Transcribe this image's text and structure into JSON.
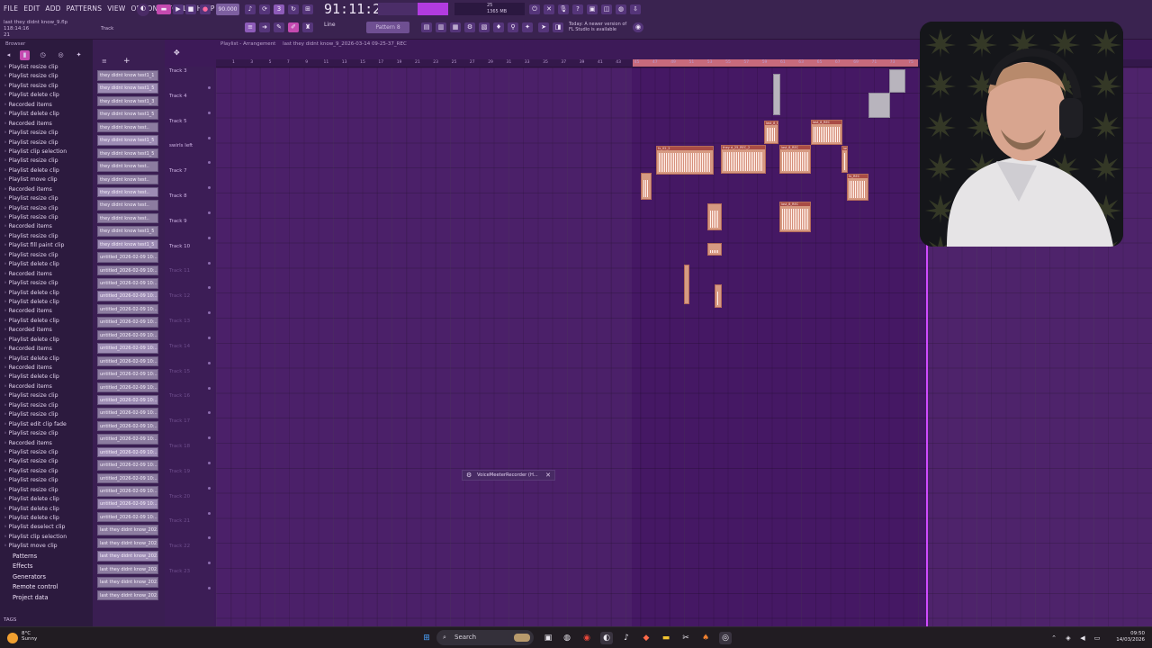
{
  "menu": [
    "FILE",
    "EDIT",
    "ADD",
    "PATTERNS",
    "VIEW",
    "OPTIONS",
    "TOOLS",
    "HELP"
  ],
  "song": {
    "name": "last they didnt know_9.flp",
    "time": "118:14:16",
    "track": "Track 21"
  },
  "transport": {
    "tempo": "90.000",
    "time": "91:11:23",
    "pattern": "Pattern 8",
    "snap": "Line",
    "memory": "1365 MB",
    "cpu": "25"
  },
  "news": {
    "line1": "Today:  A newer version of",
    "line2": "FL Studio is available"
  },
  "browser": {
    "title": "Browser",
    "history": [
      "Playlist resize clip",
      "Playlist resize clip",
      "Playlist resize clip",
      "Playlist delete clip",
      "Recorded items",
      "Playlist delete clip",
      "Recorded items",
      "Playlist resize clip",
      "Playlist resize clip",
      "Playlist clip selection",
      "Playlist resize clip",
      "Playlist delete clip",
      "Playlist move clip",
      "Recorded items",
      "Playlist resize clip",
      "Playlist resize clip",
      "Playlist resize clip",
      "Recorded items",
      "Playlist resize clip",
      "Playlist fill paint clip",
      "Playlist resize clip",
      "Playlist delete clip",
      "Recorded items",
      "Playlist resize clip",
      "Playlist delete clip",
      "Playlist delete clip",
      "Recorded items",
      "Playlist delete clip",
      "Recorded items",
      "Playlist delete clip",
      "Recorded items",
      "Playlist delete clip",
      "Recorded items",
      "Playlist delete clip",
      "Recorded items",
      "Playlist resize clip",
      "Playlist resize clip",
      "Playlist resize clip",
      "Playlist edit clip fade",
      "Playlist resize clip",
      "Recorded items",
      "Playlist resize clip",
      "Playlist resize clip",
      "Playlist resize clip",
      "Playlist resize clip",
      "Playlist resize clip",
      "Playlist delete clip",
      "Playlist delete clip",
      "Playlist delete clip",
      "Playlist deselect clip",
      "Playlist clip selection",
      "Playlist move clip"
    ],
    "sections": [
      "Patterns",
      "Effects",
      "Generators",
      "Remote control",
      "Project data"
    ],
    "tags": "TAGS"
  },
  "clips": [
    "they didnt know test1_1",
    "they didnt know test1_5",
    "they didnt know test1_3",
    "they didnt know test1_5",
    "they didnt know test..",
    "they didnt know test1_5",
    "they didnt know test1_5",
    "they didnt know test..",
    "they didnt know test..",
    "they didnt know test..",
    "they didnt know test..",
    "they didnt know test..",
    "they didnt know test1_5",
    "they didnt know test1_5",
    "untitled_2026-02-09 10:..",
    "untitled_2026-02-09 10:..",
    "untitled_2026-02-09 10:..",
    "untitled_2026-02-09 10:..",
    "untitled_2026-02-09 10:..",
    "untitled_2026-02-09 10:..",
    "untitled_2026-02-09 10:..",
    "untitled_2026-02-09 10:..",
    "untitled_2026-02-09 10:..",
    "untitled_2026-02-09 10:..",
    "untitled_2026-02-09 10:..",
    "untitled_2026-02-09 10:..",
    "untitled_2026-02-09 10:..",
    "untitled_2026-02-09 10:..",
    "untitled_2026-02-09 10:..",
    "untitled_2026-02-09 10:..",
    "untitled_2026-02-09 10:..",
    "untitled_2026-02-09 10:..",
    "untitled_2026-02-09 10:..",
    "untitled_2026-02-09 10:..",
    "untitled_2026-02-09 10:..",
    "last they didnt know_202..",
    "last they didnt know_202..",
    "last they didnt know_202..",
    "last they didnt know_202..",
    "last they didnt know_202..",
    "last they didnt know_202.."
  ],
  "playlist": {
    "title": "Playlist - Arrangement",
    "file": "last they didnt know_9_2026-03-14 09-25-37_REC"
  },
  "tracks": [
    "Track 3",
    "Track 4",
    "Track 5",
    "swirls left",
    "Track 7",
    "Track 8",
    "Track 9",
    "Track 10",
    "Track 11",
    "Track 12",
    "Track 13",
    "Track 14",
    "Track 15",
    "Track 16",
    "Track 17",
    "Track 18",
    "Track 19",
    "Track 20",
    "Track 21",
    "Track 22",
    "Track 23"
  ],
  "ruler": [
    "1",
    "3",
    "5",
    "7",
    "9",
    "11",
    "13",
    "15",
    "17",
    "19",
    "21",
    "23",
    "25",
    "27",
    "29",
    "31",
    "33",
    "35",
    "37",
    "39",
    "41",
    "43",
    "45",
    "47",
    "49",
    "51",
    "53",
    "55",
    "57",
    "59",
    "61",
    "63",
    "65",
    "67",
    "69",
    "71",
    "73",
    "75",
    "77",
    "79",
    "81",
    "83",
    "85",
    "87",
    "89",
    "91",
    "93",
    "95"
  ],
  "audio_clips": [
    "last_8_REC",
    "last_8_REC",
    "fx_02_2",
    "they d_25_REC_2",
    "last_8_REC",
    "last_8_REC",
    "last_8_REC",
    "fx_REC"
  ],
  "recorder": {
    "title": "VoiceMeeterRecorder (H..."
  },
  "taskbar": {
    "temp": "8°C",
    "weather": "Sunny",
    "search": "Search",
    "time": "09:50",
    "date": "14/03/2026"
  }
}
